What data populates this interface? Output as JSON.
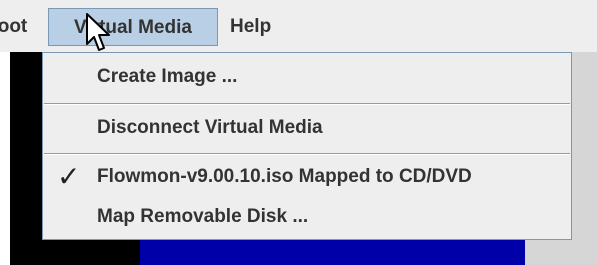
{
  "menubar": {
    "items": [
      {
        "label": "Boot"
      },
      {
        "label": "Virtual Media"
      },
      {
        "label": "Help"
      }
    ]
  },
  "dropdown": {
    "items": [
      {
        "label": "Create Image ...",
        "checked": false
      },
      {
        "label": "Disconnect Virtual Media",
        "checked": false
      },
      {
        "label": "Flowmon-v9.00.10.iso Mapped to CD/DVD",
        "checked": true
      },
      {
        "label": "Map Removable Disk ...",
        "checked": false
      }
    ],
    "check_glyph": "✓"
  },
  "colors": {
    "menu_bg": "#eeeeee",
    "active_menu_bg": "#b8cfe5",
    "border": "#7a98b4",
    "console_black": "#000000",
    "console_blue": "#0000a8"
  },
  "cursor_icon": "arrow-cursor-icon"
}
